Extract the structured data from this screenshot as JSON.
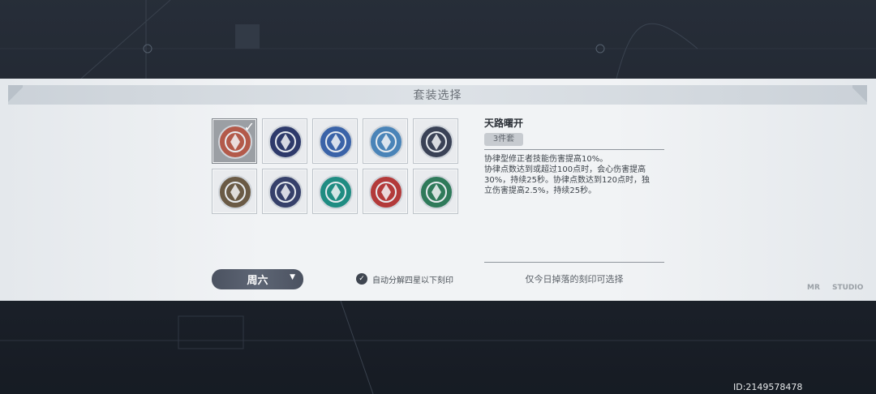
{
  "dialog": {
    "title": "套装选择"
  },
  "sets": [
    {
      "icon": "sun-emblem-icon",
      "selected": true,
      "color": "#b35a4a"
    },
    {
      "icon": "eye-orb-icon",
      "selected": false,
      "color": "#2e3a6b"
    },
    {
      "icon": "pegasus-icon",
      "selected": false,
      "color": "#3a63a8"
    },
    {
      "icon": "winged-horse-icon",
      "selected": false,
      "color": "#4a84b8"
    },
    {
      "icon": "diamond-crest-icon",
      "selected": false,
      "color": "#3a4256"
    },
    {
      "icon": "bronze-fan-icon",
      "selected": false,
      "color": "#6a5a45"
    },
    {
      "icon": "sword-crest-icon",
      "selected": false,
      "color": "#36406a"
    },
    {
      "icon": "teal-shuriken-icon",
      "selected": false,
      "color": "#1f8c82"
    },
    {
      "icon": "red-sword-shield-icon",
      "selected": false,
      "color": "#b33a3a"
    },
    {
      "icon": "golden-fist-icon",
      "selected": false,
      "color": "#2f7a5a"
    }
  ],
  "detail": {
    "name": "天路曙开",
    "pieces": "3件套",
    "lines": [
      "协律型修正者技能伤害提高10%。",
      "协律点数达到或超过100点时，会心伤害提高",
      "30%，持续25秒。协律点数达到120点时，独",
      "立伤害提高2.5%，持续25秒。"
    ],
    "drop_hint": "仅今日掉落的刻印可选择"
  },
  "day_select": {
    "value": "周六"
  },
  "auto_decompose": {
    "label": "自动分解四星以下刻印",
    "checked": true
  },
  "logos": {
    "left": "MR",
    "right": "STUDIO"
  },
  "id_text": "ID:2149578478"
}
